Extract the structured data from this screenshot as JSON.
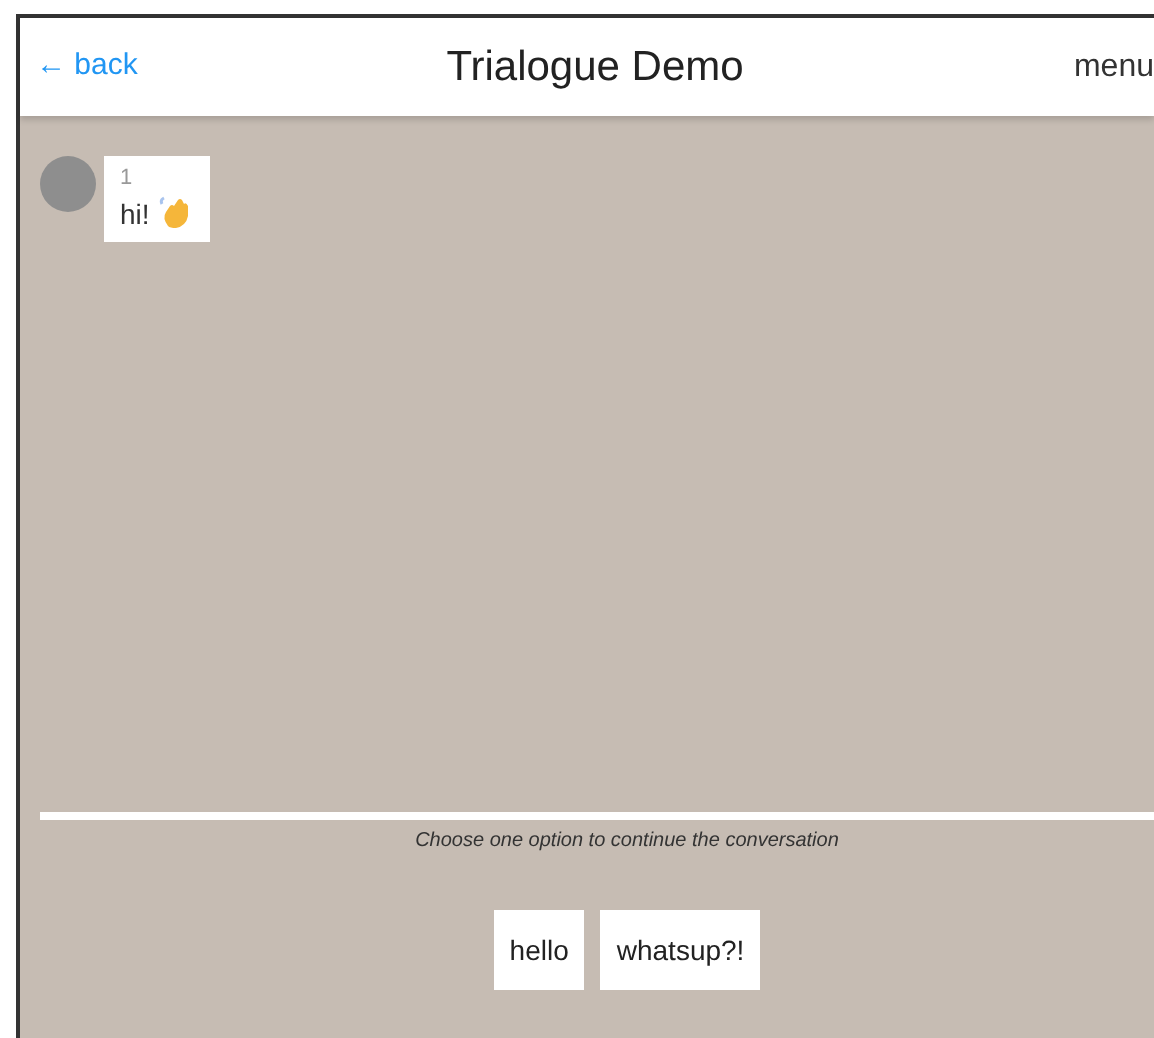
{
  "header": {
    "back": "← back",
    "title": "Trialogue Demo",
    "menu": "menu"
  },
  "messages": [
    {
      "sender": "1",
      "text": "hi!",
      "emoji": true
    }
  ],
  "prompt": "Choose one option to continue the conversation",
  "options": [
    "hello",
    "whatsup?!"
  ]
}
